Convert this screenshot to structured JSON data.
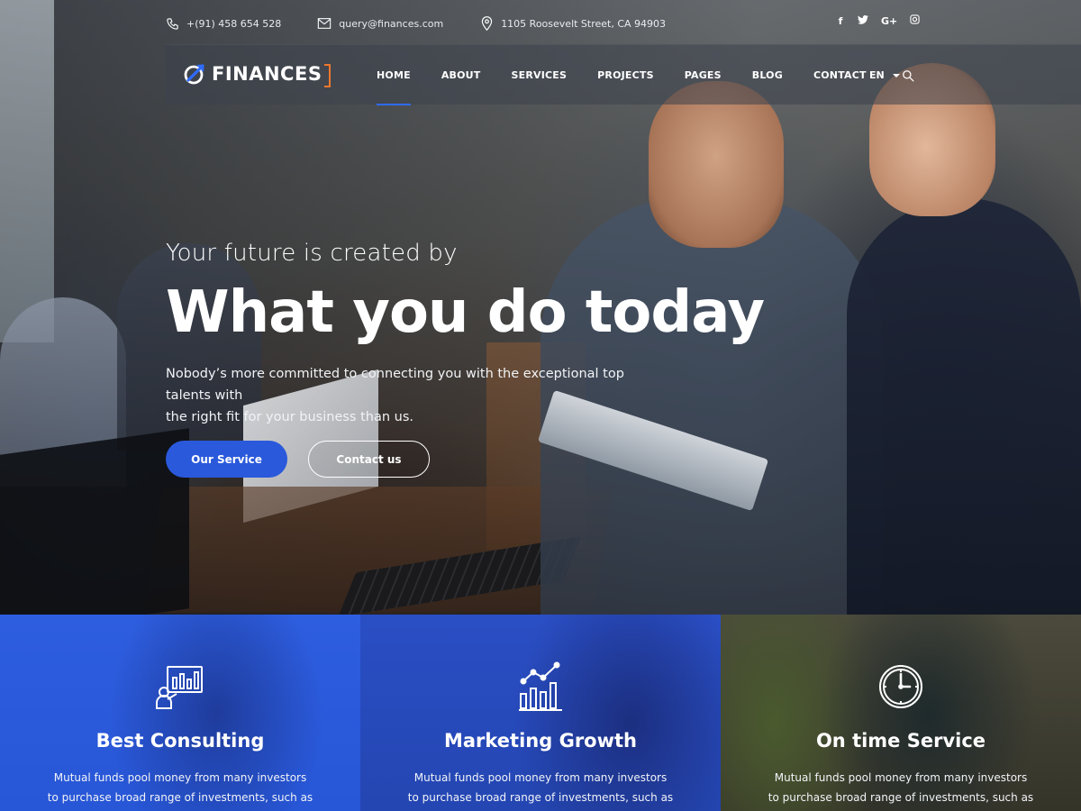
{
  "topbar": {
    "phone": "+(91) 458 654 528",
    "email": "query@finances.com",
    "address": "1105 Roosevelt Street, CA 94903",
    "social": [
      "f",
      "t",
      "G+",
      "ig"
    ]
  },
  "nav": {
    "logo_text": "FINANCES",
    "items": [
      "HOME",
      "ABOUT",
      "SERVICES",
      "PROJECTS",
      "PAGES",
      "BLOG",
      "CONTACT"
    ],
    "active": "HOME",
    "language": "EN"
  },
  "hero": {
    "pretitle": "Your future is created by",
    "title": "What you do today",
    "description_line1": "Nobody’s more committed to connecting you with the exceptional top talents with",
    "description_line2": "the right fit for your business than us.",
    "primary_button": "Our Service",
    "secondary_button": "Contact us"
  },
  "features": [
    {
      "icon": "presentation-chart-icon",
      "title": "Best Consulting",
      "text_line1": "Mutual funds pool money from many investors",
      "text_line2": "to purchase broad range of investments, such as"
    },
    {
      "icon": "growth-chart-icon",
      "title": "Marketing Growth",
      "text_line1": "Mutual funds pool money from many investors",
      "text_line2": "to purchase broad range of investments, such as"
    },
    {
      "icon": "clock-icon",
      "title": "On time Service",
      "text_line1": "Mutual funds pool money from many investors",
      "text_line2": "to purchase broad range of investments, such as"
    }
  ],
  "colors": {
    "primary_blue": "#2a59db",
    "accent_orange": "#f0772c",
    "nav_underline": "#2f6bff"
  }
}
